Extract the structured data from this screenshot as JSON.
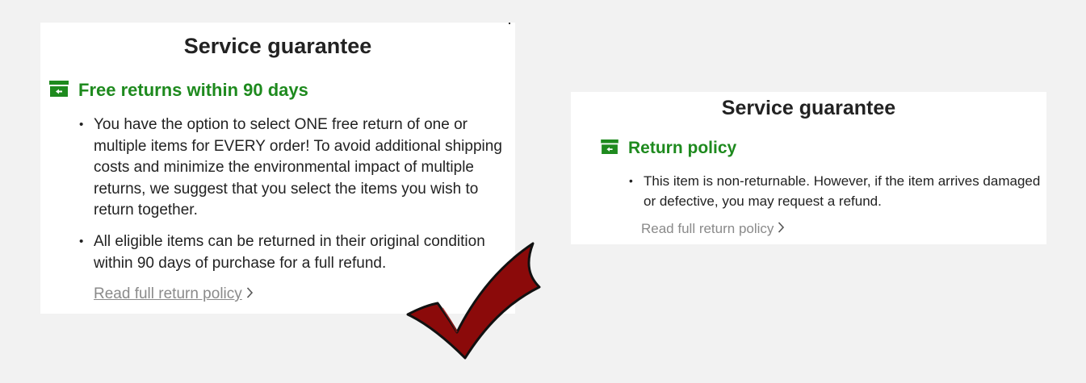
{
  "cards": [
    {
      "title": "Service guarantee",
      "section_label": "Free returns within 90 days",
      "bullets": [
        "You have the option to select ONE free return of one or multiple items for EVERY order! To avoid additional shipping costs and minimize the environmental impact of multiple returns, we suggest that you select the items you wish to return together.",
        "All eligible items can be returned in their original condition within 90 days of purchase for a full refund."
      ],
      "link_label": "Read full return policy",
      "icon": "archive-box-icon"
    },
    {
      "title": "Service guarantee",
      "section_label": "Return policy",
      "bullets": [
        "This item is non-returnable. However, if the item arrives damaged or defective, you may request a refund."
      ],
      "link_label": "Read full return policy",
      "icon": "archive-box-icon"
    }
  ],
  "overlay": {
    "icon": "checkmark-icon",
    "color": "#8b0a0a"
  },
  "colors": {
    "accent_green": "#1e8a1e",
    "link_gray": "#8a8a8a",
    "background": "#f2f2f2"
  }
}
